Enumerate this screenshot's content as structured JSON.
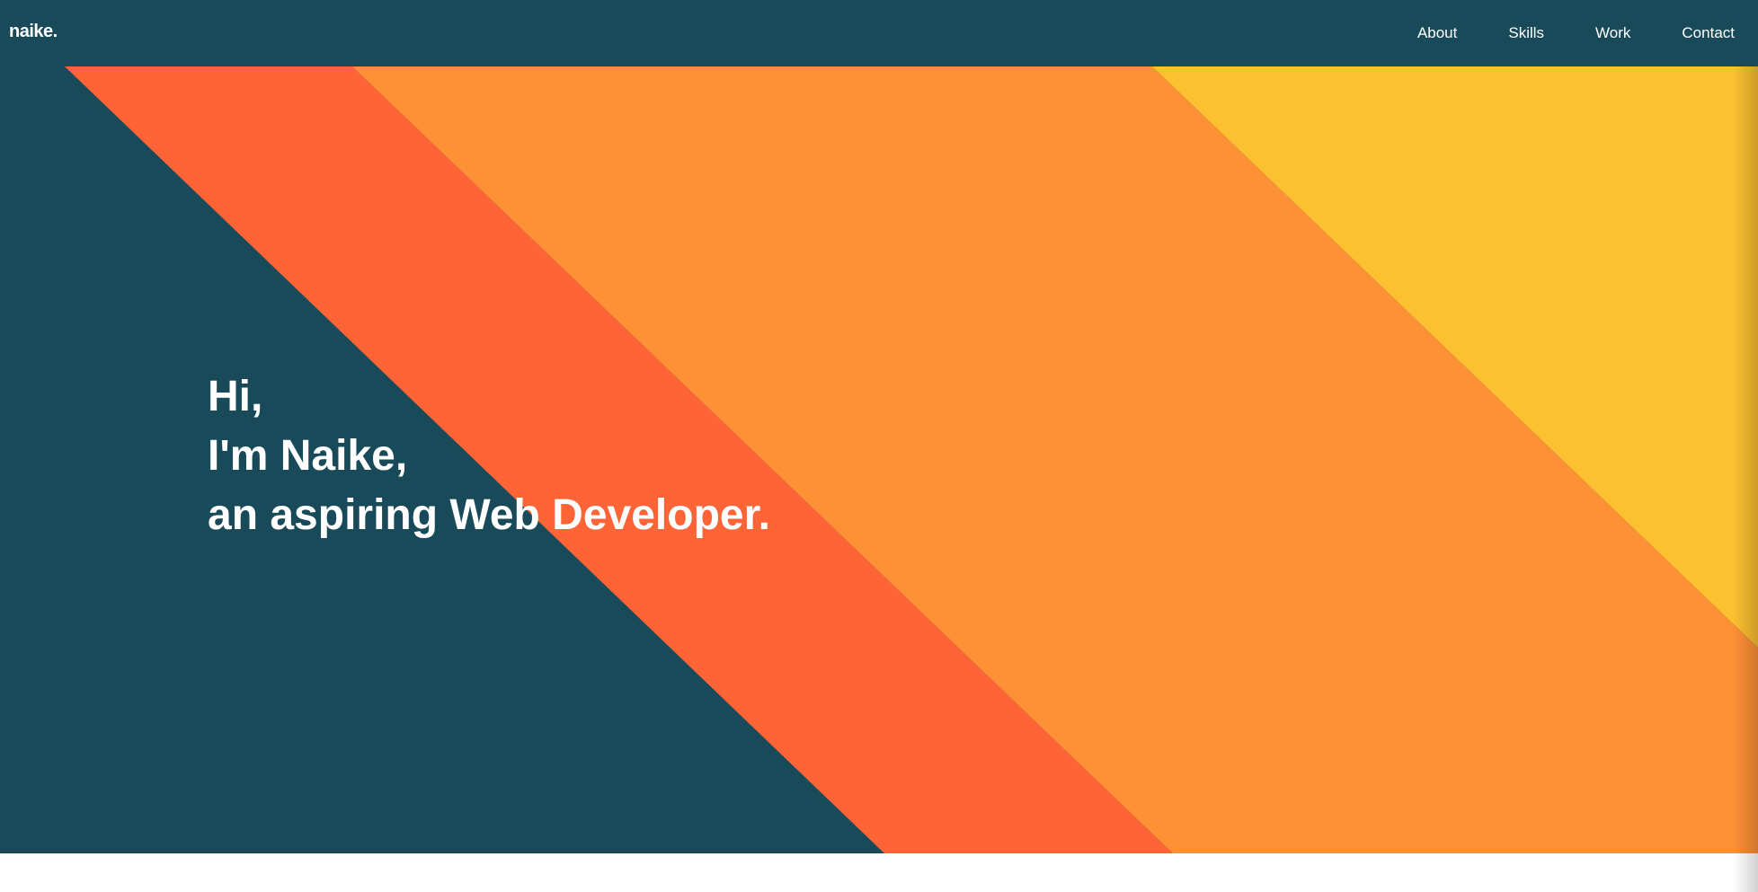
{
  "brand": {
    "logo_text": "naike."
  },
  "nav": {
    "items": [
      {
        "label": "About"
      },
      {
        "label": "Skills"
      },
      {
        "label": "Work"
      },
      {
        "label": "Contact"
      }
    ]
  },
  "hero": {
    "lines": [
      "Hi,",
      "I'm Naike,",
      "an aspiring Web Developer."
    ]
  },
  "colors": {
    "navy": "#184a5a",
    "red_orange": "#fe6436",
    "orange": "#fe9036",
    "yellow": "#fcc031",
    "white": "#ffffff"
  }
}
